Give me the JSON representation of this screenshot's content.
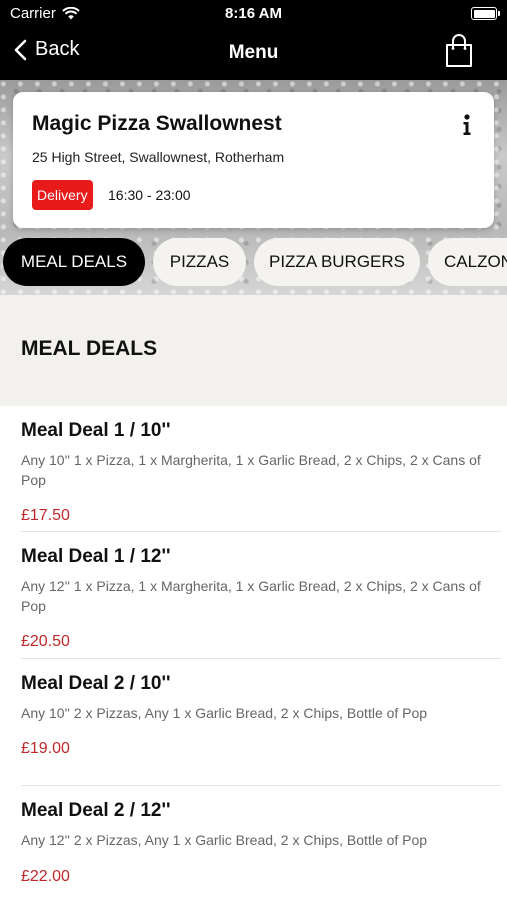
{
  "status_bar": {
    "carrier": "Carrier",
    "time": "8:16 AM"
  },
  "nav": {
    "back_label": "Back",
    "title": "Menu"
  },
  "restaurant": {
    "name": "Magic Pizza Swallownest",
    "address": "25 High Street, Swallownest, Rotherham",
    "service_badge": "Delivery",
    "hours": "16:30 - 23:00"
  },
  "tabs": [
    {
      "label": "MEAL DEALS",
      "active": true
    },
    {
      "label": "PIZZAS",
      "active": false
    },
    {
      "label": "PIZZA BURGERS",
      "active": false
    },
    {
      "label": "CALZONE",
      "active": false
    }
  ],
  "section": {
    "title": "MEAL DEALS"
  },
  "items": [
    {
      "name": "Meal Deal 1 / 10''",
      "description": "Any 10''  1 x Pizza, 1 x Margherita, 1 x Garlic Bread, 2 x Chips, 2 x Cans of Pop",
      "price": "£17.50"
    },
    {
      "name": "Meal Deal 1 / 12''",
      "description": "Any 12''  1 x Pizza, 1 x Margherita, 1 x Garlic Bread, 2 x Chips, 2 x Cans of Pop",
      "price": "£20.50"
    },
    {
      "name": "Meal Deal 2 / 10''",
      "description": "Any 10''  2 x Pizzas, Any 1 x Garlic Bread, 2 x Chips, Bottle of Pop",
      "price": "£19.00"
    },
    {
      "name": "Meal Deal 2 / 12''",
      "description": "Any 12''  2 x Pizzas, Any 1 x Garlic Bread, 2 x Chips, Bottle of Pop",
      "price": "£22.00"
    }
  ],
  "colors": {
    "accent": "#e81a1a",
    "price": "#c0282d",
    "bar": "#000000",
    "section_bg": "#f3f1ed"
  }
}
